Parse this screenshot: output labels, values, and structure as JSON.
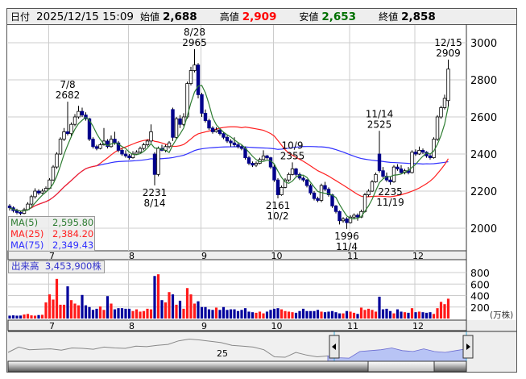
{
  "header": {
    "date_label": "日付",
    "datetime": "2025/12/15 15:09",
    "open_label": "始値",
    "open": "2,688",
    "high_label": "高値",
    "high": "2,909",
    "low_label": "安値",
    "low": "2,653",
    "close_label": "終値",
    "close": "2,858"
  },
  "legend": {
    "ma5": {
      "label": "MA(5)",
      "value": "2,595.80",
      "color": "#2e7d32"
    },
    "ma25": {
      "label": "MA(25)",
      "value": "2,384.20",
      "color": "#ff2020"
    },
    "ma75": {
      "label": "MA(75)",
      "value": "2,349.43",
      "color": "#3030ff"
    }
  },
  "volume_label": {
    "label": "出来高",
    "value": "3,453,900株"
  },
  "volume_unit": "(万株)",
  "navigator": {
    "year_label": "25",
    "values": [
      2050,
      2110,
      2080,
      2085,
      2090,
      2075,
      2100,
      2095,
      2085,
      2110,
      2100,
      2095,
      2120,
      2115,
      2130,
      2140,
      2180,
      2200,
      2190,
      2175,
      2160,
      2130,
      2120,
      2110,
      2080,
      2000,
      1995,
      2050,
      2020,
      2000,
      2010,
      1990,
      1985,
      2060,
      2070,
      2080,
      2100,
      2070,
      2060,
      2090,
      2060,
      2050,
      2070,
      2090
    ]
  },
  "chart_data": {
    "type": "candlestick",
    "price_axis": {
      "min": 2000,
      "max": 3000,
      "ticks": [
        2000,
        2200,
        2400,
        2600,
        2800,
        3000
      ]
    },
    "volume_axis": {
      "min": 0,
      "max": 800,
      "ticks": [
        200,
        400,
        600,
        800
      ],
      "unit": "(万株)"
    },
    "months": [
      {
        "label": "7",
        "index": 11
      },
      {
        "label": "8",
        "index": 33
      },
      {
        "label": "9",
        "index": 53
      },
      {
        "label": "10",
        "index": 73
      },
      {
        "label": "11",
        "index": 94
      },
      {
        "label": "12",
        "index": 112
      }
    ],
    "annotations": [
      {
        "date": "7/8",
        "value": "2682",
        "index": 16,
        "pos": "above"
      },
      {
        "date": "8/28",
        "value": "2965",
        "index": 51,
        "pos": "above"
      },
      {
        "date": "8/14",
        "value": "2231",
        "index": 40,
        "pos": "below"
      },
      {
        "date": "10/2",
        "value": "2161",
        "index": 74,
        "pos": "below"
      },
      {
        "date": "10/9",
        "value": "2355",
        "index": 78,
        "pos": "above"
      },
      {
        "date": "11/4",
        "value": "1996",
        "index": 93,
        "pos": "below"
      },
      {
        "date": "11/14",
        "value": "2525",
        "index": 102,
        "pos": "above"
      },
      {
        "date": "11/19",
        "value": "2235",
        "index": 105,
        "pos": "below"
      },
      {
        "date": "12/15",
        "value": "2909",
        "index": 121,
        "pos": "above"
      }
    ],
    "ohlc": [
      [
        2120,
        2130,
        2095,
        2110
      ],
      [
        2110,
        2118,
        2085,
        2095
      ],
      [
        2095,
        2105,
        2075,
        2085
      ],
      [
        2085,
        2095,
        2070,
        2080
      ],
      [
        2080,
        2110,
        2075,
        2100
      ],
      [
        2100,
        2140,
        2095,
        2130
      ],
      [
        2130,
        2180,
        2120,
        2170
      ],
      [
        2170,
        2215,
        2160,
        2200
      ],
      [
        2200,
        2210,
        2180,
        2190
      ],
      [
        2190,
        2212,
        2185,
        2200
      ],
      [
        2200,
        2225,
        2195,
        2215
      ],
      [
        2215,
        2270,
        2210,
        2260
      ],
      [
        2260,
        2340,
        2255,
        2330
      ],
      [
        2330,
        2410,
        2320,
        2400
      ],
      [
        2400,
        2490,
        2395,
        2480
      ],
      [
        2480,
        2540,
        2470,
        2520
      ],
      [
        2520,
        2682,
        2500,
        2510
      ],
      [
        2510,
        2570,
        2490,
        2560
      ],
      [
        2560,
        2615,
        2550,
        2600
      ],
      [
        2600,
        2660,
        2590,
        2630
      ],
      [
        2630,
        2650,
        2600,
        2610
      ],
      [
        2610,
        2625,
        2580,
        2590
      ],
      [
        2590,
        2595,
        2470,
        2480
      ],
      [
        2480,
        2490,
        2430,
        2440
      ],
      [
        2440,
        2450,
        2420,
        2430
      ],
      [
        2430,
        2460,
        2425,
        2450
      ],
      [
        2450,
        2540,
        2445,
        2470
      ],
      [
        2470,
        2480,
        2430,
        2440
      ],
      [
        2440,
        2500,
        2435,
        2480
      ],
      [
        2480,
        2520,
        2450,
        2460
      ],
      [
        2460,
        2470,
        2410,
        2420
      ],
      [
        2420,
        2430,
        2390,
        2400
      ],
      [
        2400,
        2420,
        2380,
        2390
      ],
      [
        2390,
        2400,
        2370,
        2380
      ],
      [
        2380,
        2415,
        2375,
        2400
      ],
      [
        2400,
        2420,
        2395,
        2410
      ],
      [
        2410,
        2440,
        2400,
        2430
      ],
      [
        2430,
        2460,
        2420,
        2450
      ],
      [
        2450,
        2480,
        2440,
        2470
      ],
      [
        2470,
        2560,
        2460,
        2520
      ],
      [
        2400,
        2410,
        2231,
        2290
      ],
      [
        2290,
        2440,
        2280,
        2430
      ],
      [
        2430,
        2450,
        2415,
        2420
      ],
      [
        2420,
        2450,
        2410,
        2440
      ],
      [
        2440,
        2470,
        2430,
        2460
      ],
      [
        2640,
        2650,
        2470,
        2490
      ],
      [
        2490,
        2600,
        2480,
        2590
      ],
      [
        2590,
        2610,
        2540,
        2560
      ],
      [
        2560,
        2620,
        2550,
        2600
      ],
      [
        2600,
        2790,
        2590,
        2780
      ],
      [
        2780,
        2870,
        2770,
        2850
      ],
      [
        2850,
        2965,
        2840,
        2880
      ],
      [
        2880,
        2890,
        2700,
        2720
      ],
      [
        2720,
        2730,
        2600,
        2620
      ],
      [
        2620,
        2640,
        2570,
        2580
      ],
      [
        2580,
        2590,
        2530,
        2540
      ],
      [
        2540,
        2550,
        2510,
        2520
      ],
      [
        2520,
        2545,
        2515,
        2530
      ],
      [
        2530,
        2540,
        2500,
        2510
      ],
      [
        2510,
        2520,
        2480,
        2490
      ],
      [
        2490,
        2500,
        2460,
        2470
      ],
      [
        2470,
        2480,
        2440,
        2460
      ],
      [
        2460,
        2490,
        2440,
        2450
      ],
      [
        2450,
        2460,
        2430,
        2440
      ],
      [
        2440,
        2450,
        2420,
        2430
      ],
      [
        2430,
        2440,
        2370,
        2380
      ],
      [
        2380,
        2390,
        2340,
        2350
      ],
      [
        2350,
        2360,
        2330,
        2340
      ],
      [
        2340,
        2360,
        2330,
        2350
      ],
      [
        2350,
        2380,
        2345,
        2370
      ],
      [
        2370,
        2420,
        2365,
        2390
      ],
      [
        2390,
        2395,
        2370,
        2380
      ],
      [
        2380,
        2385,
        2320,
        2330
      ],
      [
        2330,
        2340,
        2250,
        2260
      ],
      [
        2260,
        2270,
        2161,
        2180
      ],
      [
        2180,
        2230,
        2175,
        2220
      ],
      [
        2220,
        2270,
        2215,
        2260
      ],
      [
        2260,
        2300,
        2250,
        2290
      ],
      [
        2290,
        2355,
        2285,
        2320
      ],
      [
        2320,
        2325,
        2280,
        2290
      ],
      [
        2290,
        2300,
        2260,
        2270
      ],
      [
        2270,
        2280,
        2250,
        2260
      ],
      [
        2260,
        2265,
        2220,
        2230
      ],
      [
        2230,
        2240,
        2180,
        2190
      ],
      [
        2190,
        2200,
        2150,
        2160
      ],
      [
        2160,
        2170,
        2140,
        2150
      ],
      [
        2150,
        2240,
        2140,
        2230
      ],
      [
        2230,
        2250,
        2200,
        2210
      ],
      [
        2210,
        2220,
        2170,
        2180
      ],
      [
        2180,
        2185,
        2110,
        2120
      ],
      [
        2120,
        2125,
        2080,
        2090
      ],
      [
        2090,
        2095,
        2020,
        2040
      ],
      [
        2040,
        2060,
        2030,
        2050
      ],
      [
        2050,
        2060,
        1996,
        2030
      ],
      [
        2030,
        2070,
        2025,
        2060
      ],
      [
        2060,
        2080,
        2050,
        2070
      ],
      [
        2070,
        2080,
        2040,
        2060
      ],
      [
        2060,
        2100,
        2055,
        2090
      ],
      [
        2090,
        2190,
        2085,
        2180
      ],
      [
        2180,
        2210,
        2170,
        2200
      ],
      [
        2200,
        2260,
        2195,
        2250
      ],
      [
        2250,
        2300,
        2245,
        2290
      ],
      [
        2400,
        2525,
        2300,
        2310
      ],
      [
        2310,
        2330,
        2270,
        2280
      ],
      [
        2280,
        2300,
        2250,
        2260
      ],
      [
        2260,
        2280,
        2235,
        2250
      ],
      [
        2250,
        2340,
        2245,
        2330
      ],
      [
        2330,
        2345,
        2310,
        2320
      ],
      [
        2320,
        2340,
        2295,
        2300
      ],
      [
        2300,
        2320,
        2290,
        2310
      ],
      [
        2310,
        2330,
        2290,
        2300
      ],
      [
        2300,
        2420,
        2295,
        2410
      ],
      [
        2410,
        2425,
        2390,
        2400
      ],
      [
        2400,
        2440,
        2395,
        2420
      ],
      [
        2420,
        2430,
        2400,
        2410
      ],
      [
        2410,
        2415,
        2380,
        2390
      ],
      [
        2390,
        2400,
        2370,
        2380
      ],
      [
        2380,
        2490,
        2375,
        2480
      ],
      [
        2480,
        2610,
        2470,
        2600
      ],
      [
        2600,
        2660,
        2590,
        2650
      ],
      [
        2650,
        2720,
        2640,
        2700
      ],
      [
        2688,
        2909,
        2653,
        2858
      ]
    ],
    "volume": [
      50,
      55,
      50,
      52,
      70,
      80,
      55,
      50,
      60,
      65,
      280,
      420,
      330,
      690,
      240,
      240,
      560,
      320,
      260,
      230,
      410,
      230,
      200,
      150,
      170,
      210,
      150,
      390,
      260,
      160,
      180,
      180,
      170,
      170,
      130,
      160,
      120,
      130,
      170,
      160,
      740,
      770,
      320,
      280,
      460,
      420,
      240,
      310,
      170,
      530,
      420,
      260,
      300,
      200,
      200,
      160,
      150,
      190,
      150,
      200,
      150,
      160,
      160,
      130,
      150,
      180,
      120,
      110,
      100,
      120,
      90,
      120,
      150,
      170,
      180,
      160,
      130,
      120,
      110,
      100,
      130,
      170,
      130,
      130,
      130,
      150,
      120,
      110,
      120,
      130,
      110,
      90,
      90,
      130,
      120,
      100,
      80,
      190,
      150,
      170,
      150,
      120,
      380,
      160,
      170,
      130,
      90,
      160,
      120,
      110,
      100,
      180,
      110,
      120,
      110,
      100,
      110,
      80,
      180,
      290,
      250,
      345
    ],
    "colors": {
      "up_body": "#ffffff",
      "down_body": "#00008b",
      "up_volume": "#ff1a1a",
      "down_volume": "#00009c"
    }
  }
}
